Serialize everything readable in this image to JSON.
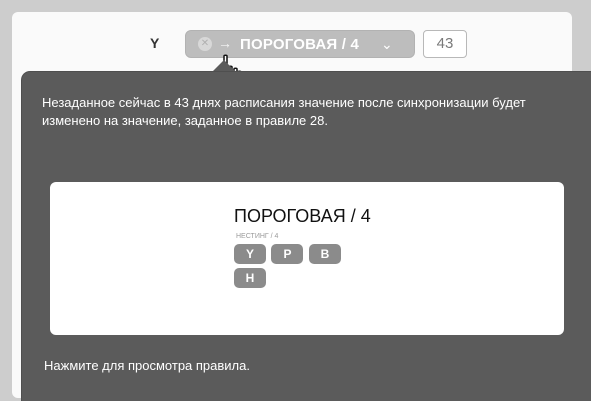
{
  "header": {
    "y_label": "Y",
    "pill_text": "ПОРОГОВАЯ / 4",
    "count": "43",
    "arrow": "→",
    "chevron": "⌄"
  },
  "tooltip": {
    "description": "Незаданное сейчас в 43 днях расписания значение после синхронизации будет изменено на значение, заданное в правиле 28.",
    "rule_title": "ПОРОГОВАЯ / 4",
    "rule_subtitle": "НЕСТИНГ / 4",
    "chips": [
      "Y",
      "P",
      "B",
      "H"
    ],
    "footer": "Нажмите для просмотра правила."
  }
}
